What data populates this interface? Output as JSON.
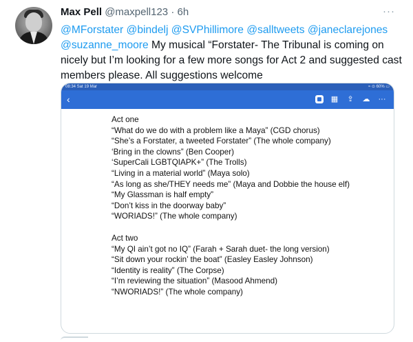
{
  "tweet": {
    "name": "Max Pell",
    "handle": "@maxpell123",
    "separator": "·",
    "time": "6h",
    "more_icon": "more-horizontal-icon",
    "mentions_line1": "@MForstater @bindelj @SVPhillimore @salltweets @janeclarejones",
    "mention_last": "@suzanne_moore",
    "body": " My musical “Forstater- The Tribunal is coming on nicely but I’m looking for a few more songs for Act 2 and suggested cast members please. All suggestions welcome"
  },
  "media": {
    "status_left": "08:34  Sat 19 Mar",
    "status_right": "≈ ⊙ 60% ▭",
    "back_icon": "chevron-left-icon",
    "toolbar_icons": [
      "reader-mode-icon",
      "grid-icon",
      "share-icon",
      "upload-icon",
      "more-icon"
    ],
    "act_one_title": "Act one",
    "act_one": [
      "“What do we do with a problem like a Maya” (CGD chorus)",
      "“She’s a Forstater, a tweeted Forstater” (The whole company)",
      "‘Bring in the clowns” (Ben Cooper)",
      "‘SuperCali LGBTQIAPK+” (The Trolls)",
      "“Living in a material world” (Maya solo)",
      "“As long as she/THEY needs me” (Maya and Dobbie the house elf)",
      "“My Glassman is half empty”",
      "“Don’t kiss in the doorway baby”",
      "“WORIADS!” (The whole company)"
    ],
    "act_two_title": "Act two",
    "act_two": [
      "“My QI ain’t got no IQ” (Farah + Sarah duet- the long version)",
      "“Sit down your rockin’ the boat” (Easley Easley Johnson)",
      "“Identity is reality” (The Corpse)",
      "“I’m reviewing the situation” (Masood Ahmend)",
      "“NWORIADS!” (The whole company)"
    ]
  }
}
